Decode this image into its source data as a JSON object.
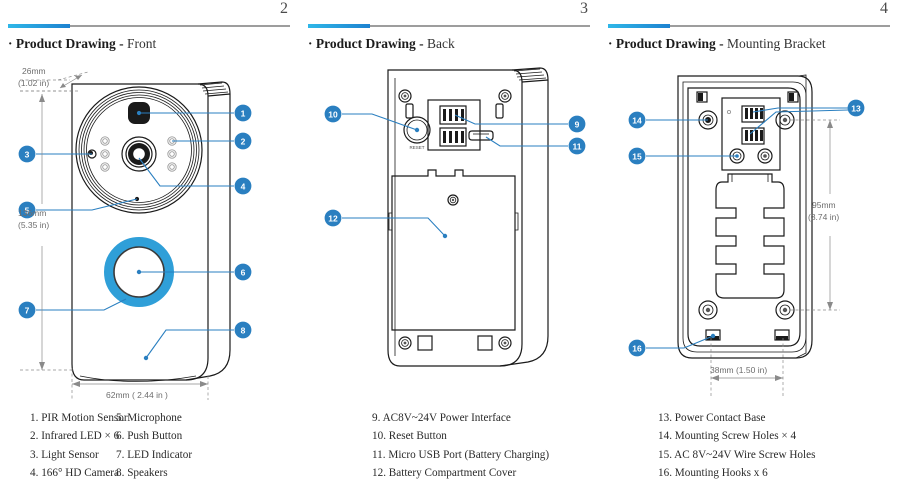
{
  "document": {
    "type": "product-drawing-manual",
    "accent_color_start": "#2fb7e8",
    "accent_color_end": "#1d82d0",
    "callout_color": "#2a7fc0",
    "button_ring_color": "#2f9fd8",
    "button_inner_color": "#58b4e0"
  },
  "panels": [
    {
      "page_number": "2",
      "title_bullet": "·",
      "title_strong": "Product Drawing",
      "title_sep": "-",
      "title_light": "Front",
      "dimensions": {
        "depth_mm": "26mm",
        "depth_in": "(1.02 in)",
        "height_mm": "136mm",
        "height_in": "(5.35 in)",
        "width": "62mm ( 2.44 in )"
      },
      "callouts": [
        "1",
        "2",
        "3",
        "4",
        "5",
        "6",
        "7",
        "8"
      ],
      "legend_left": [
        "1. PIR Motion Sensor",
        "2. Infrared LED × 6",
        "3. Light Sensor",
        "4. 166°  HD Camera"
      ],
      "legend_right": [
        "5. Microphone",
        "6. Push Button",
        "7. LED Indicator",
        "8. Speakers"
      ]
    },
    {
      "page_number": "3",
      "title_bullet": "·",
      "title_strong": "Product Drawing",
      "title_sep": "-",
      "title_light": "Back",
      "reset_label": "RESET",
      "callouts": [
        "9",
        "10",
        "11",
        "12"
      ],
      "legend_left": [
        "9. AC8V~24V Power Interface",
        "10. Reset Button",
        "11. Micro USB Port (Battery Charging)",
        "12. Battery Compartment Cover"
      ]
    },
    {
      "page_number": "4",
      "title_bullet": "·",
      "title_strong": "Product Drawing",
      "title_sep": "-",
      "title_light": "Mounting Bracket",
      "dimensions": {
        "height_mm": "95mm",
        "height_in": "(3.74 in)",
        "width": "38mm (1.50 in)"
      },
      "callouts": [
        "13",
        "14",
        "15",
        "16"
      ],
      "legend_left": [
        "13. Power Contact Base",
        "14. Mounting Screw Holes × 4",
        "15. AC 8V~24V Wire Screw Holes",
        "16. Mounting Hooks x 6"
      ]
    }
  ]
}
